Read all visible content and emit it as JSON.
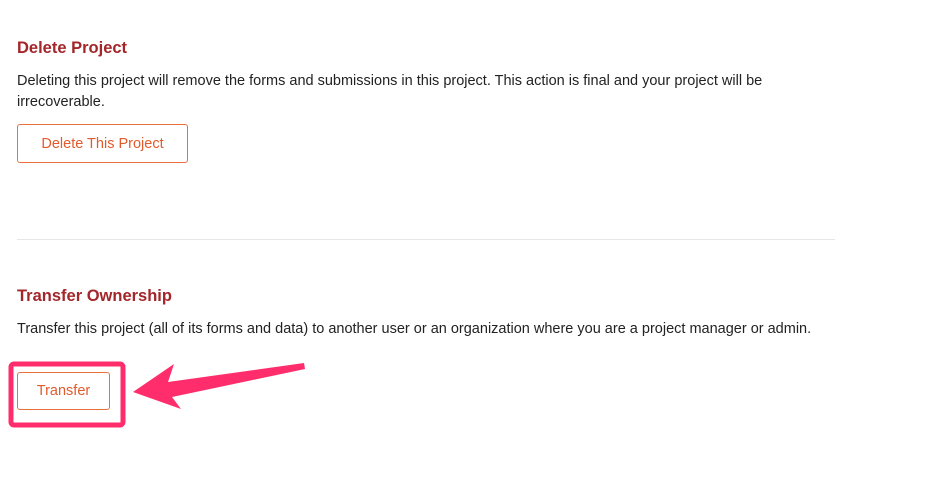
{
  "delete_section": {
    "title": "Delete Project",
    "description": "Deleting this project will remove the forms and submissions in this project. This action is final and your project will be irrecoverable.",
    "button_label": "Delete This Project"
  },
  "transfer_section": {
    "title": "Transfer Ownership",
    "description": "Transfer this project (all of its forms and data) to another user or an organization where you are a project manager or admin.",
    "button_label": "Transfer"
  },
  "annotation": {
    "color": "#ff2d6b"
  }
}
